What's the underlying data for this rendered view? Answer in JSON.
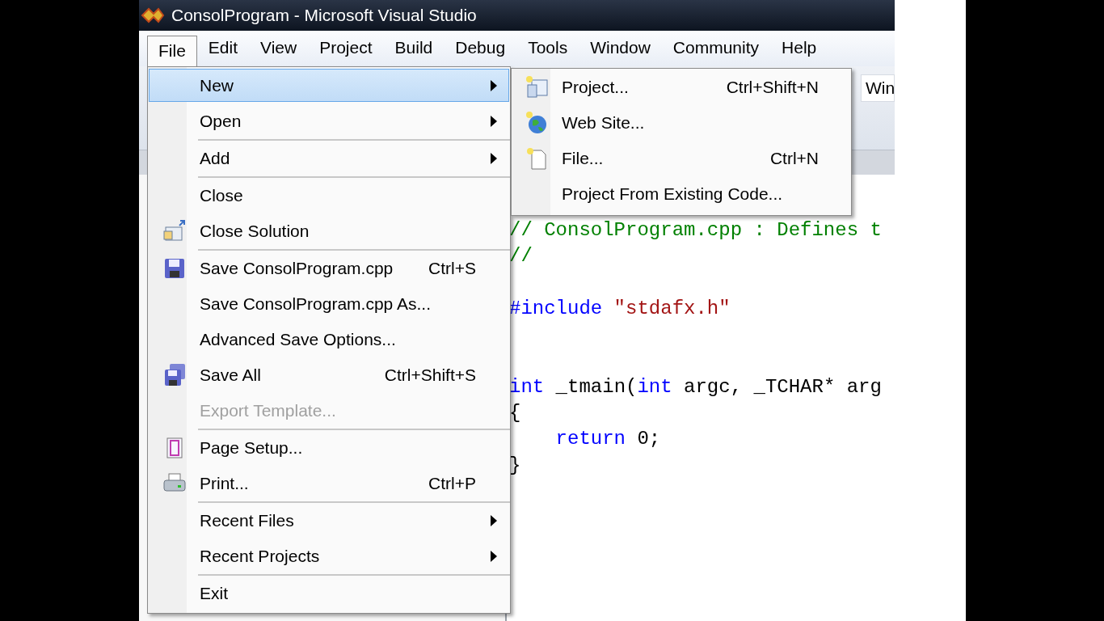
{
  "window": {
    "title": "ConsolProgram - Microsoft Visual Studio"
  },
  "menu_bar": [
    {
      "label": "File",
      "selected": true
    },
    {
      "label": "Edit",
      "selected": false
    },
    {
      "label": "View",
      "selected": false
    },
    {
      "label": "Project",
      "selected": false
    },
    {
      "label": "Build",
      "selected": false
    },
    {
      "label": "Debug",
      "selected": false
    },
    {
      "label": "Tools",
      "selected": false
    },
    {
      "label": "Window",
      "selected": false
    },
    {
      "label": "Community",
      "selected": false
    },
    {
      "label": "Help",
      "selected": false
    }
  ],
  "toolbar": {
    "combo_value": "Win"
  },
  "file_menu": {
    "items": [
      {
        "kind": "item",
        "label": "New",
        "submenu": true,
        "selected": true,
        "disabled": false
      },
      {
        "kind": "item",
        "label": "Open",
        "submenu": true,
        "selected": false,
        "disabled": false
      },
      {
        "kind": "separator"
      },
      {
        "kind": "item",
        "label": "Add",
        "submenu": true,
        "selected": false,
        "disabled": false
      },
      {
        "kind": "separator"
      },
      {
        "kind": "item",
        "label": "Close",
        "submenu": false,
        "selected": false,
        "disabled": false
      },
      {
        "kind": "item",
        "label": "Close Solution",
        "submenu": false,
        "selected": false,
        "disabled": false
      },
      {
        "kind": "separator"
      },
      {
        "kind": "item",
        "label": "Save ConsolProgram.cpp",
        "shortcut": "Ctrl+S",
        "submenu": false,
        "selected": false,
        "disabled": false
      },
      {
        "kind": "item",
        "label": "Save ConsolProgram.cpp As...",
        "submenu": false,
        "selected": false,
        "disabled": false
      },
      {
        "kind": "item",
        "label": "Advanced Save Options...",
        "submenu": false,
        "selected": false,
        "disabled": false
      },
      {
        "kind": "item",
        "label": "Save All",
        "shortcut": "Ctrl+Shift+S",
        "submenu": false,
        "selected": false,
        "disabled": false
      },
      {
        "kind": "item",
        "label": "Export Template...",
        "submenu": false,
        "selected": false,
        "disabled": true
      },
      {
        "kind": "separator"
      },
      {
        "kind": "item",
        "label": "Page Setup...",
        "submenu": false,
        "selected": false,
        "disabled": false
      },
      {
        "kind": "item",
        "label": "Print...",
        "shortcut": "Ctrl+P",
        "submenu": false,
        "selected": false,
        "disabled": false
      },
      {
        "kind": "separator"
      },
      {
        "kind": "item",
        "label": "Recent Files",
        "submenu": true,
        "selected": false,
        "disabled": false
      },
      {
        "kind": "item",
        "label": "Recent Projects",
        "submenu": true,
        "selected": false,
        "disabled": false
      },
      {
        "kind": "separator"
      },
      {
        "kind": "item",
        "label": "Exit",
        "submenu": false,
        "selected": false,
        "disabled": false
      }
    ]
  },
  "new_submenu": {
    "items": [
      {
        "label": "Project...",
        "shortcut": "Ctrl+Shift+N"
      },
      {
        "label": "Web Site..."
      },
      {
        "label": "File...",
        "shortcut": "Ctrl+N"
      },
      {
        "label": "Project From Existing Code..."
      }
    ]
  },
  "editor": {
    "lines": [
      {
        "kind": "code",
        "tokens": [
          {
            "kind": "comment",
            "text": "// ConsolProgram.cpp : Defines t"
          }
        ]
      },
      {
        "kind": "code",
        "tokens": [
          {
            "kind": "comment",
            "text": "//"
          }
        ]
      },
      {
        "kind": "blank"
      },
      {
        "kind": "code",
        "tokens": [
          {
            "kind": "keyword",
            "text": "#include"
          },
          {
            "kind": "string",
            "text": " \"stdafx.h\""
          }
        ]
      },
      {
        "kind": "blank"
      },
      {
        "kind": "blank"
      },
      {
        "kind": "code",
        "tokens": [
          {
            "kind": "keyword",
            "text": "int"
          },
          {
            "kind": "plain",
            "text": " _tmain("
          },
          {
            "kind": "keyword",
            "text": "int"
          },
          {
            "kind": "plain",
            "text": " argc, _TCHAR* arg"
          }
        ]
      },
      {
        "kind": "code",
        "tokens": [
          {
            "kind": "plain",
            "text": "{"
          }
        ]
      },
      {
        "kind": "code",
        "tokens": [
          {
            "kind": "keyword",
            "text": "    return"
          },
          {
            "kind": "plain",
            "text": " 0;"
          }
        ]
      },
      {
        "kind": "code",
        "tokens": [
          {
            "kind": "plain",
            "text": "}"
          }
        ]
      }
    ]
  }
}
